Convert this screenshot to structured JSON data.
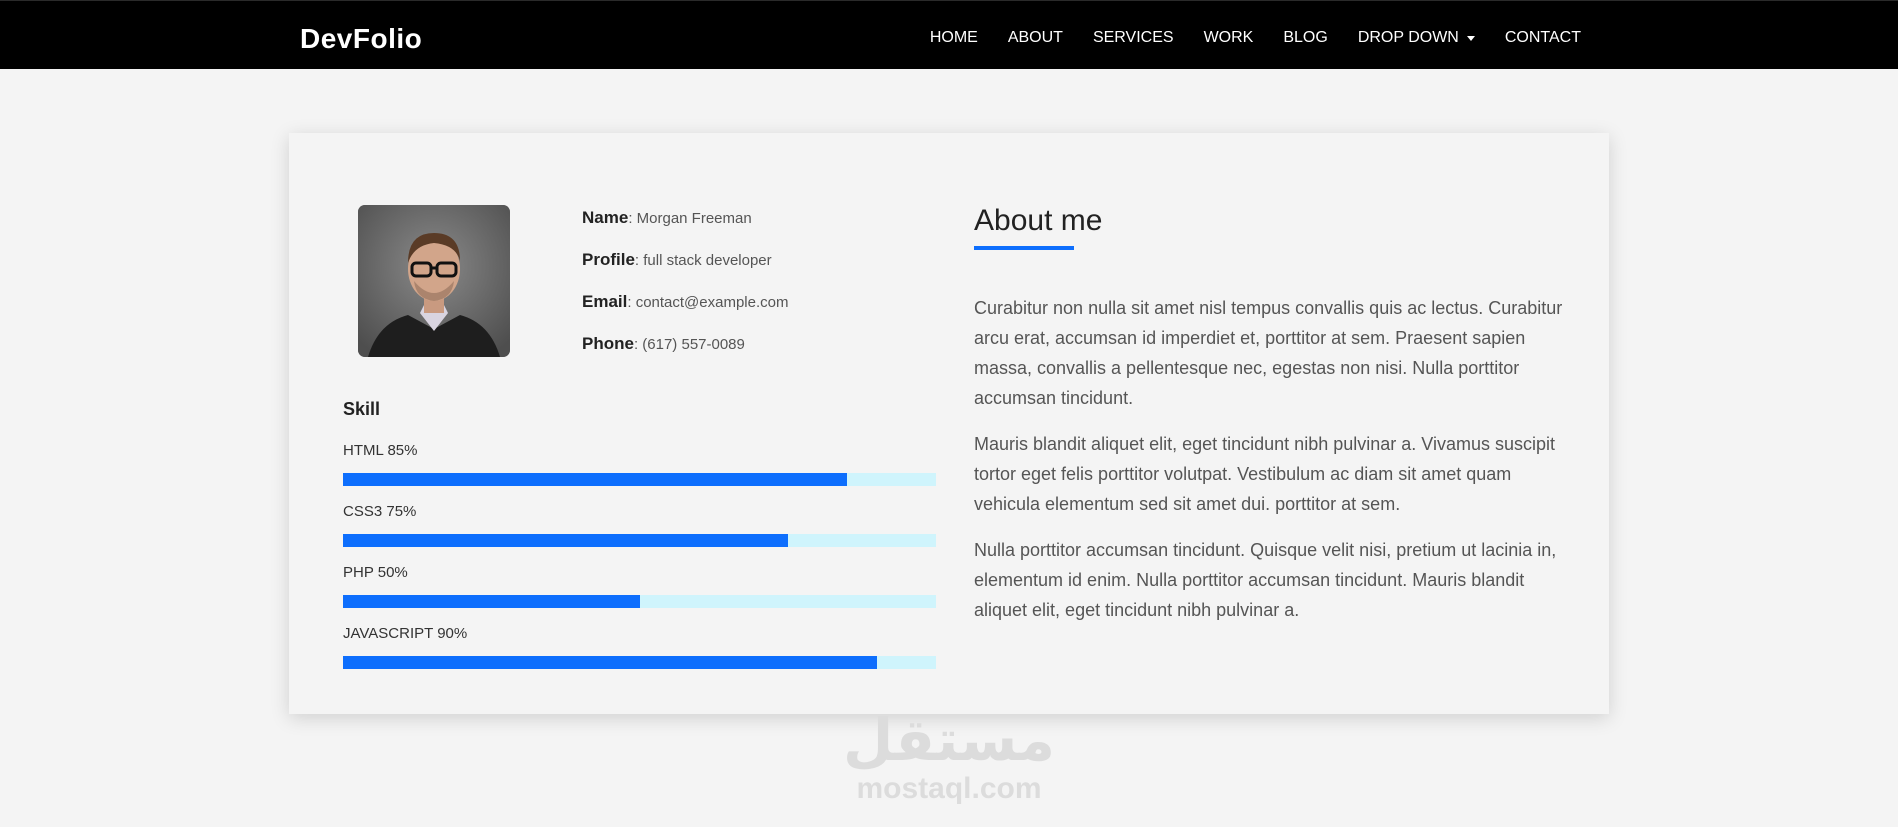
{
  "navbar": {
    "brand": "DevFolio",
    "links": [
      "HOME",
      "ABOUT",
      "SERVICES",
      "WORK",
      "BLOG",
      "DROP DOWN",
      "CONTACT"
    ]
  },
  "profile": {
    "name_label": "Name",
    "name": ": Morgan Freeman",
    "profile_label": "Profile",
    "profile": ": full stack developer",
    "email_label": "Email",
    "email": ": contact@example.com",
    "phone_label": "Phone",
    "phone": ": (617) 557-0089"
  },
  "skills": {
    "title": "Skill",
    "items": [
      {
        "label": "HTML 85%",
        "percent": 85
      },
      {
        "label": "CSS3 75%",
        "percent": 75
      },
      {
        "label": "PHP 50%",
        "percent": 50
      },
      {
        "label": "JAVASCRIPT 90%",
        "percent": 90
      }
    ]
  },
  "about": {
    "title": "About me",
    "paragraphs": [
      "Curabitur non nulla sit amet nisl tempus convallis quis ac lectus. Curabitur arcu erat, accumsan id imperdiet et, porttitor at sem. Praesent sapien massa, convallis a pellentesque nec, egestas non nisi. Nulla porttitor accumsan tincidunt.",
      "Mauris blandit aliquet elit, eget tincidunt nibh pulvinar a. Vivamus suscipit tortor eget felis porttitor volutpat. Vestibulum ac diam sit amet quam vehicula elementum sed sit amet dui. porttitor at sem.",
      "Nulla porttitor accumsan tincidunt. Quisque velit nisi, pretium ut lacinia in, elementum id enim. Nulla porttitor accumsan tincidunt. Mauris blandit aliquet elit, eget tincidunt nibh pulvinar a."
    ]
  },
  "watermark": {
    "arabic": "مستقل",
    "latin": "mostaql.com"
  },
  "colors": {
    "navbar_bg": "#000000",
    "accent": "#0d6efd",
    "bar_track": "#cff4fc",
    "page_bg": "#f4f4f4"
  }
}
